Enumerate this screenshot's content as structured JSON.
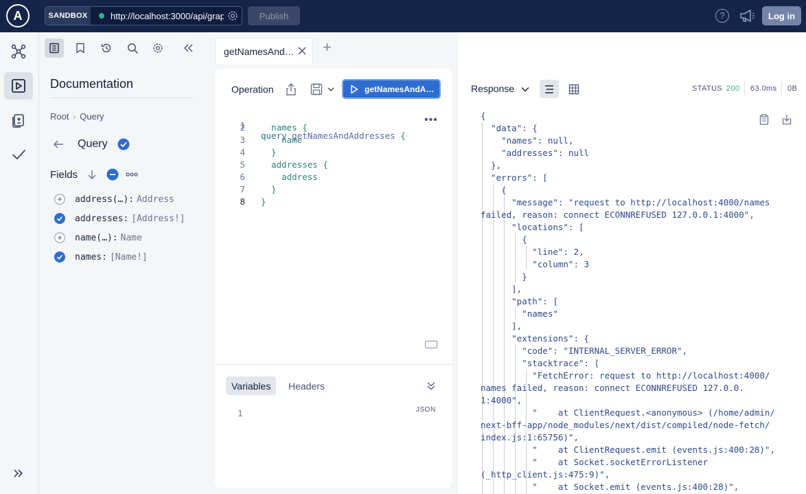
{
  "topbar": {
    "logo_letter": "A",
    "sandbox_label": "SANDBOX",
    "url": "http://localhost:3000/api/graphql",
    "publish_label": "Publish",
    "help_label": "?",
    "login_label": "Log in"
  },
  "docs": {
    "title": "Documentation",
    "breadcrumb": [
      "Root",
      "Query"
    ],
    "breadcrumb_sep": "›",
    "type_title": "Query",
    "fields_label": "Fields",
    "fields": [
      {
        "name": "address(…):",
        "type": "Address",
        "selected": false
      },
      {
        "name": "addresses:",
        "type": "[Address!]",
        "selected": true
      },
      {
        "name": "name(…):",
        "type": "Name",
        "selected": false
      },
      {
        "name": "names:",
        "type": "[Name!]",
        "selected": true
      }
    ]
  },
  "editor": {
    "tab_label": "getNamesAnd…",
    "operation_label": "Operation",
    "run_label": "getNamesAndA…",
    "lines": [
      {
        "n": "1",
        "kw": "query ",
        "name": "getNamesAndAddresses",
        "rest": " {"
      },
      {
        "n": "2",
        "kw": "",
        "name": "",
        "rest": "  names {"
      },
      {
        "n": "3",
        "kw": "",
        "name": "",
        "rest": "    name"
      },
      {
        "n": "4",
        "kw": "",
        "name": "",
        "rest": "  }"
      },
      {
        "n": "5",
        "kw": "",
        "name": "",
        "rest": "  addresses {"
      },
      {
        "n": "6",
        "kw": "",
        "name": "",
        "rest": "    address"
      },
      {
        "n": "7",
        "kw": "",
        "name": "",
        "rest": "  }"
      },
      {
        "n": "8",
        "kw": "",
        "name": "",
        "rest": "}"
      }
    ],
    "variables_tab": "Variables",
    "headers_tab": "Headers",
    "json_label": "JSON",
    "variables_line": "1"
  },
  "response": {
    "title": "Response",
    "status_label": "STATUS",
    "status_code": "200",
    "time": "63.0ms",
    "size": "0B",
    "lines": [
      "{",
      "  \"data\": {",
      "    \"names\": null,",
      "    \"addresses\": null",
      "  },",
      "  \"errors\": [",
      "    {",
      "      \"message\": \"request to http://localhost:4000/names",
      "failed, reason: connect ECONNREFUSED 127.0.0.1:4000\",",
      "      \"locations\": [",
      "        {",
      "          \"line\": 2,",
      "          \"column\": 3",
      "        }",
      "      ],",
      "      \"path\": [",
      "        \"names\"",
      "      ],",
      "      \"extensions\": {",
      "        \"code\": \"INTERNAL_SERVER_ERROR\",",
      "        \"stacktrace\": [",
      "          \"FetchError: request to http://localhost:4000/",
      "names failed, reason: connect ECONNREFUSED 127.0.0.",
      "1:4000\",",
      "          \"    at ClientRequest.<anonymous> (/home/admin/",
      "next-bff-app/node_modules/next/dist/compiled/node-fetch/",
      "index.js:1:65756)\",",
      "          \"    at ClientRequest.emit (events.js:400:28)\",",
      "          \"    at Socket.socketErrorListener",
      "(_http_client.js:475:9)\",",
      "          \"    at Socket.emit (events.js:400:28)\","
    ]
  }
}
